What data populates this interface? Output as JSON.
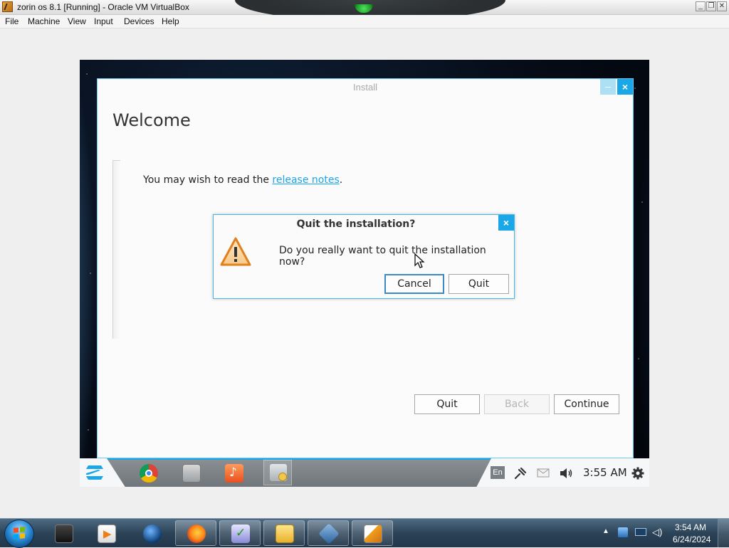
{
  "host": {
    "title": "zorin os 8.1 [Running] - Oracle VM VirtualBox",
    "menu": [
      "File",
      "Machine",
      "View",
      "Input",
      "Devices",
      "Help"
    ],
    "window_controls": [
      "minimize-icon",
      "restore-icon",
      "close-icon"
    ]
  },
  "installer": {
    "title": "Install",
    "heading": "Welcome",
    "intro_prefix": "You may wish to read the ",
    "intro_link": "release notes",
    "intro_suffix": ".",
    "buttons": {
      "quit": "Quit",
      "back": "Back",
      "continue": "Continue"
    },
    "close_glyph": "×",
    "minimize_glyph": "–"
  },
  "dialog": {
    "title": "Quit the installation?",
    "message": "Do you really want to quit the installation now?",
    "cancel": "Cancel",
    "quit": "Quit",
    "icon": "warning-icon",
    "close_glyph": "×"
  },
  "guest_panel": {
    "apps": [
      "chrome-icon",
      "files-icon",
      "music-icon",
      "installer-icon"
    ],
    "language": "En",
    "tray_icons": [
      "network-icon",
      "mail-icon",
      "volume-icon",
      "settings-icon"
    ],
    "time": "3:55 AM"
  },
  "host_taskbar": {
    "apps": [
      "terminal-icon",
      "media-player-icon",
      "browser-globe-icon",
      "firefox-icon",
      "checklist-icon",
      "file-manager-icon",
      "virtualbox-icon",
      "app-64-icon"
    ],
    "time": "3:54 AM",
    "date": "6/24/2024"
  },
  "colors": {
    "accent": "#1aa7e8",
    "warning": "#f0a020"
  }
}
